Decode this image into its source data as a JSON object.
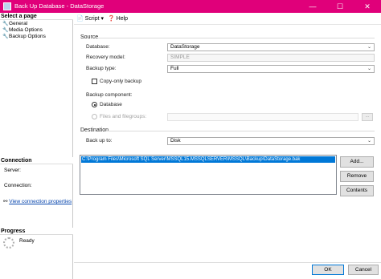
{
  "window": {
    "title": "Back Up Database - DataStorage",
    "min_glyph": "—",
    "max_glyph": "☐",
    "close_glyph": "✕"
  },
  "left_pane": {
    "select_page_heading": "Select a page",
    "pages": [
      {
        "label": "General",
        "icon": "wrench-icon"
      },
      {
        "label": "Media Options",
        "icon": "wrench-icon"
      },
      {
        "label": "Backup Options",
        "icon": "wrench-icon"
      }
    ],
    "connection_heading": "Connection",
    "server_label": "Server:",
    "connection_label": "Connection:",
    "view_connection_link": "View connection properties",
    "progress_heading": "Progress",
    "progress_status": "Ready"
  },
  "toolbar": {
    "script_label": "Script",
    "help_label": "Help"
  },
  "source": {
    "heading": "Source",
    "database_label": "Database:",
    "database_value": "DataStorage",
    "recovery_model_label": "Recovery model:",
    "recovery_model_value": "SIMPLE",
    "backup_type_label": "Backup type:",
    "backup_type_value": "Full",
    "copy_only_label": "Copy-only backup",
    "copy_only_checked": false,
    "backup_component_label": "Backup component:",
    "component_database_label": "Database",
    "component_files_label": "Files and filegroups:"
  },
  "destination": {
    "heading": "Destination",
    "back_up_to_label": "Back up to:",
    "back_up_to_value": "Disk",
    "paths": [
      "C:\\Program Files\\Microsoft SQL Server\\MSSQL15.MSSQLSERVER\\MSSQL\\Backup\\DataStorage.bak"
    ],
    "add_button": "Add...",
    "remove_button": "Remove",
    "contents_button": "Contents"
  },
  "footer": {
    "ok_button": "OK",
    "cancel_button": "Cancel"
  },
  "colors": {
    "titlebar": "#e0007a",
    "selection": "#0078d7",
    "link": "#0645ad"
  }
}
